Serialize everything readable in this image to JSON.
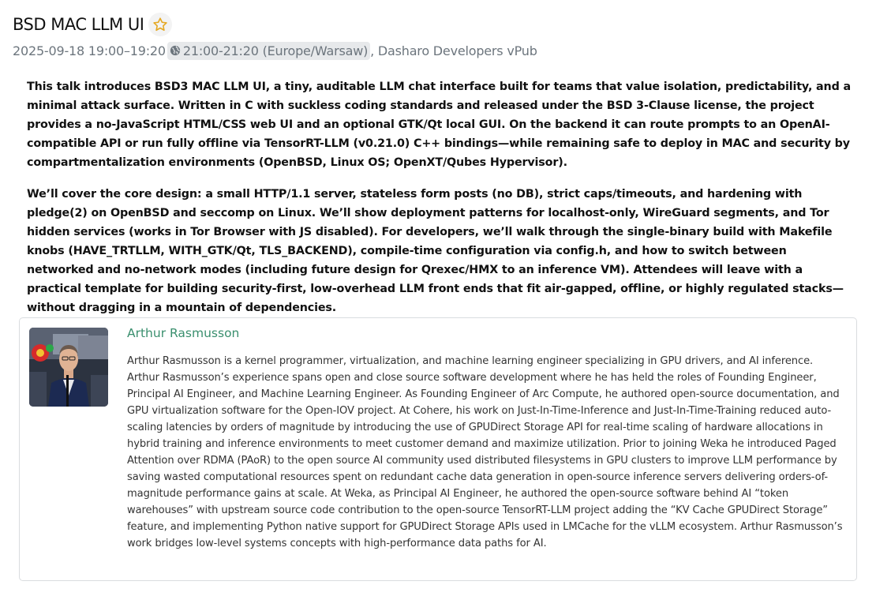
{
  "talk": {
    "title": "BSD MAC LLM UI",
    "time_range": "2025-09-18 19:00–19:20",
    "local_time": "21:00-21:20 (Europe/Warsaw)",
    "event": ", Dasharo Developers vPub",
    "abstract": [
      "This talk introduces BSD3 MAC LLM UI, a tiny, auditable LLM chat interface built for teams that value isolation, predictability, and a minimal attack surface. Written in C with suckless coding standards and released under the BSD 3-Clause license, the project provides a no-JavaScript HTML/CSS web UI and an optional GTK/Qt local GUI. On the backend it can route prompts to an OpenAI-compatible API or run fully offline via TensorRT-LLM (v0.21.0) C++ bindings—while remaining safe to deploy in MAC and security by compartmentalization environments (OpenBSD, Linux OS; OpenXT/Qubes Hypervisor).",
      "We’ll cover the core design: a small HTTP/1.1 server, stateless form posts (no DB), strict caps/timeouts, and hardening with pledge(2) on OpenBSD and seccomp on Linux. We’ll show deployment patterns for localhost-only, WireGuard segments, and Tor hidden services (works in Tor Browser with JS disabled). For developers, we’ll walk through the single-binary build with Makefile knobs (HAVE_TRTLLM, WITH_GTK/Qt, TLS_BACKEND), compile-time configuration via config.h, and how to switch between networked and no-network modes (including future design for Qrexec/HMX to an inference VM). Attendees will leave with a practical template for building security-first, low-overhead LLM front ends that fit air-gapped, offline, or highly regulated stacks—without dragging in a mountain of dependencies."
    ]
  },
  "speaker": {
    "name": "Arthur Rasmusson",
    "bio": "Arthur Rasmusson is a kernel programmer, virtualization, and machine learning engineer specializing in GPU drivers, and AI inference. Arthur Rasmusson’s experience spans open and close source software development where he has held the roles of Founding Engineer, Principal AI Engineer, and Machine Learning Engineer. As Founding Engineer of Arc Compute, he authored open-source documentation, and GPU virtualization software for the Open-IOV project. At Cohere, his work on Just-In-Time-Inference and Just-In-Time-Training reduced auto-scaling latencies by orders of magnitude by introducing the use of GPUDirect Storage API for real-time scaling of hardware allocations in hybrid training and inference environments to meet customer demand and maximize utilization. Prior to joining Weka he introduced Paged Attention over RDMA (PAoR) to the open source AI community used distributed filesystems in GPU clusters to improve LLM performance by saving wasted computational resources spent on redundant cache data generation in open-source inference servers delivering orders-of-magnitude performance gains at scale. At Weka, as Principal AI Engineer, he authored the open-source software behind AI “token warehouses” with upstream source code contribution to the open-source TensorRT-LLM project adding the “KV Cache GPUDirect Storage” feature, and implementing Python native support for GPUDirect Storage APIs used in LMCache for the vLLM ecosystem. Arthur Rasmusson’s work bridges low-level systems concepts with high-performance data paths for AI."
  },
  "icons": {
    "favorite": "star-outline-icon",
    "timezone": "globe-icon"
  },
  "colors": {
    "star": "#e5a823",
    "link": "#3a8f6e",
    "muted": "#6c757d",
    "badge_bg": "#e7e9eb",
    "card_border": "#d9dcdf"
  }
}
